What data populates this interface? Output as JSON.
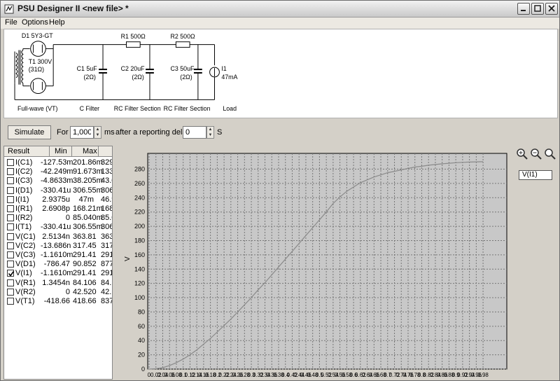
{
  "window": {
    "title": "PSU Designer II  <new file> *"
  },
  "menu": [
    "File",
    "Options",
    "Help"
  ],
  "schematic": {
    "rectifier": {
      "part": "D1 5Y3-GT",
      "transformer": "T1 300V",
      "resistance": "(31Ω)",
      "section": "Full-wave (VT)"
    },
    "c1": {
      "label": "C1 5uF",
      "esr": "(2Ω)",
      "section": "C Filter"
    },
    "r1": {
      "label": "R1 500Ω"
    },
    "c2": {
      "label": "C2 20uF",
      "esr": "(2Ω)",
      "section": "RC Filter Section"
    },
    "r2": {
      "label": "R2 500Ω"
    },
    "c3": {
      "label": "C3 50uF",
      "esr": "(2Ω)",
      "section": "RC Filter Section"
    },
    "load": {
      "name": "I1",
      "value": "47mA",
      "section": "Load"
    }
  },
  "toolbar": {
    "simulate_label": "Simulate",
    "for_label": "For",
    "duration_value": "1,000",
    "ms_label": "ms",
    "delay_label": "after a reporting delay of",
    "delay_value": "0",
    "s_label": "S"
  },
  "results": {
    "headers": {
      "result": "Result",
      "min": "Min",
      "max": "Max"
    },
    "rows": [
      {
        "name": "I(C1)",
        "min": "-127.53m",
        "max": "201.86m",
        "extra": "329.",
        "checked": false
      },
      {
        "name": "I(C2)",
        "min": "-42.249m",
        "max": "91.673m",
        "extra": "133.",
        "checked": false
      },
      {
        "name": "I(C3)",
        "min": "-4.8633m",
        "max": "38.205m",
        "extra": "43.0",
        "checked": false
      },
      {
        "name": "I(D1)",
        "min": "-330.41u",
        "max": "306.55m",
        "extra": "306.",
        "checked": false
      },
      {
        "name": "I(I1)",
        "min": "2.9375u",
        "max": "47m",
        "extra": "46.9",
        "checked": false
      },
      {
        "name": "I(R1)",
        "min": "2.6908p",
        "max": "168.21m",
        "extra": "168.",
        "checked": false
      },
      {
        "name": "I(R2)",
        "min": "0",
        "max": "85.040m",
        "extra": "85.0",
        "checked": false
      },
      {
        "name": "I(T1)",
        "min": "-330.41u",
        "max": "306.55m",
        "extra": "306.",
        "checked": false
      },
      {
        "name": "V(C1)",
        "min": "2.5134n",
        "max": "363.81",
        "extra": "363",
        "checked": false
      },
      {
        "name": "V(C2)",
        "min": "-13.686n",
        "max": "317.45",
        "extra": "317",
        "checked": false
      },
      {
        "name": "V(C3)",
        "min": "-1.1610m",
        "max": "291.41",
        "extra": "291",
        "checked": false
      },
      {
        "name": "V(D1)",
        "min": "-786.47",
        "max": "90.852",
        "extra": "877",
        "checked": false
      },
      {
        "name": "V(I1)",
        "min": "-1.1610m",
        "max": "291.41",
        "extra": "291",
        "checked": true
      },
      {
        "name": "V(R1)",
        "min": "1.3454n",
        "max": "84.106",
        "extra": "84.",
        "checked": false
      },
      {
        "name": "V(R2)",
        "min": "0",
        "max": "42.520",
        "extra": "42.",
        "checked": false
      },
      {
        "name": "V(T1)",
        "min": "-418.66",
        "max": "418.66",
        "extra": "837",
        "checked": false
      }
    ]
  },
  "chart_data": {
    "type": "line",
    "ylabel": "V",
    "xlabel": "",
    "xlim": [
      0,
      0.98
    ],
    "ylim": [
      0,
      290
    ],
    "yticks": [
      0,
      20,
      40,
      60,
      80,
      100,
      120,
      140,
      160,
      180,
      200,
      220,
      240,
      260,
      280
    ],
    "xtick_step": 0.02,
    "grid": true,
    "legend": "top-right",
    "line_color": "#8a8a8a",
    "series": [
      {
        "name": "V(I1)",
        "x": [
          0,
          0.02,
          0.04,
          0.06,
          0.08,
          0.1,
          0.12,
          0.14,
          0.16,
          0.18,
          0.2,
          0.22,
          0.24,
          0.26,
          0.28,
          0.3,
          0.32,
          0.34,
          0.36,
          0.38,
          0.4,
          0.42,
          0.44,
          0.46,
          0.48,
          0.5,
          0.52,
          0.54,
          0.56,
          0.58,
          0.6,
          0.62,
          0.64,
          0.66,
          0.68,
          0.7,
          0.72,
          0.74,
          0.76,
          0.78,
          0.8,
          0.82,
          0.84,
          0.86,
          0.88,
          0.9,
          0.92,
          0.94,
          0.96,
          0.98
        ],
        "values": [
          0,
          0.5,
          2,
          5,
          9,
          14,
          20,
          27,
          35,
          43,
          52,
          61,
          70,
          80,
          90,
          100,
          111,
          121,
          132,
          143,
          154,
          165,
          176,
          187,
          198,
          209,
          220,
          232,
          241,
          249,
          255,
          261,
          265,
          269,
          272,
          275,
          277,
          279,
          281,
          283,
          284,
          285.5,
          286.5,
          287.5,
          288.3,
          289,
          289.5,
          289.9,
          290.2,
          290.4
        ]
      }
    ]
  }
}
